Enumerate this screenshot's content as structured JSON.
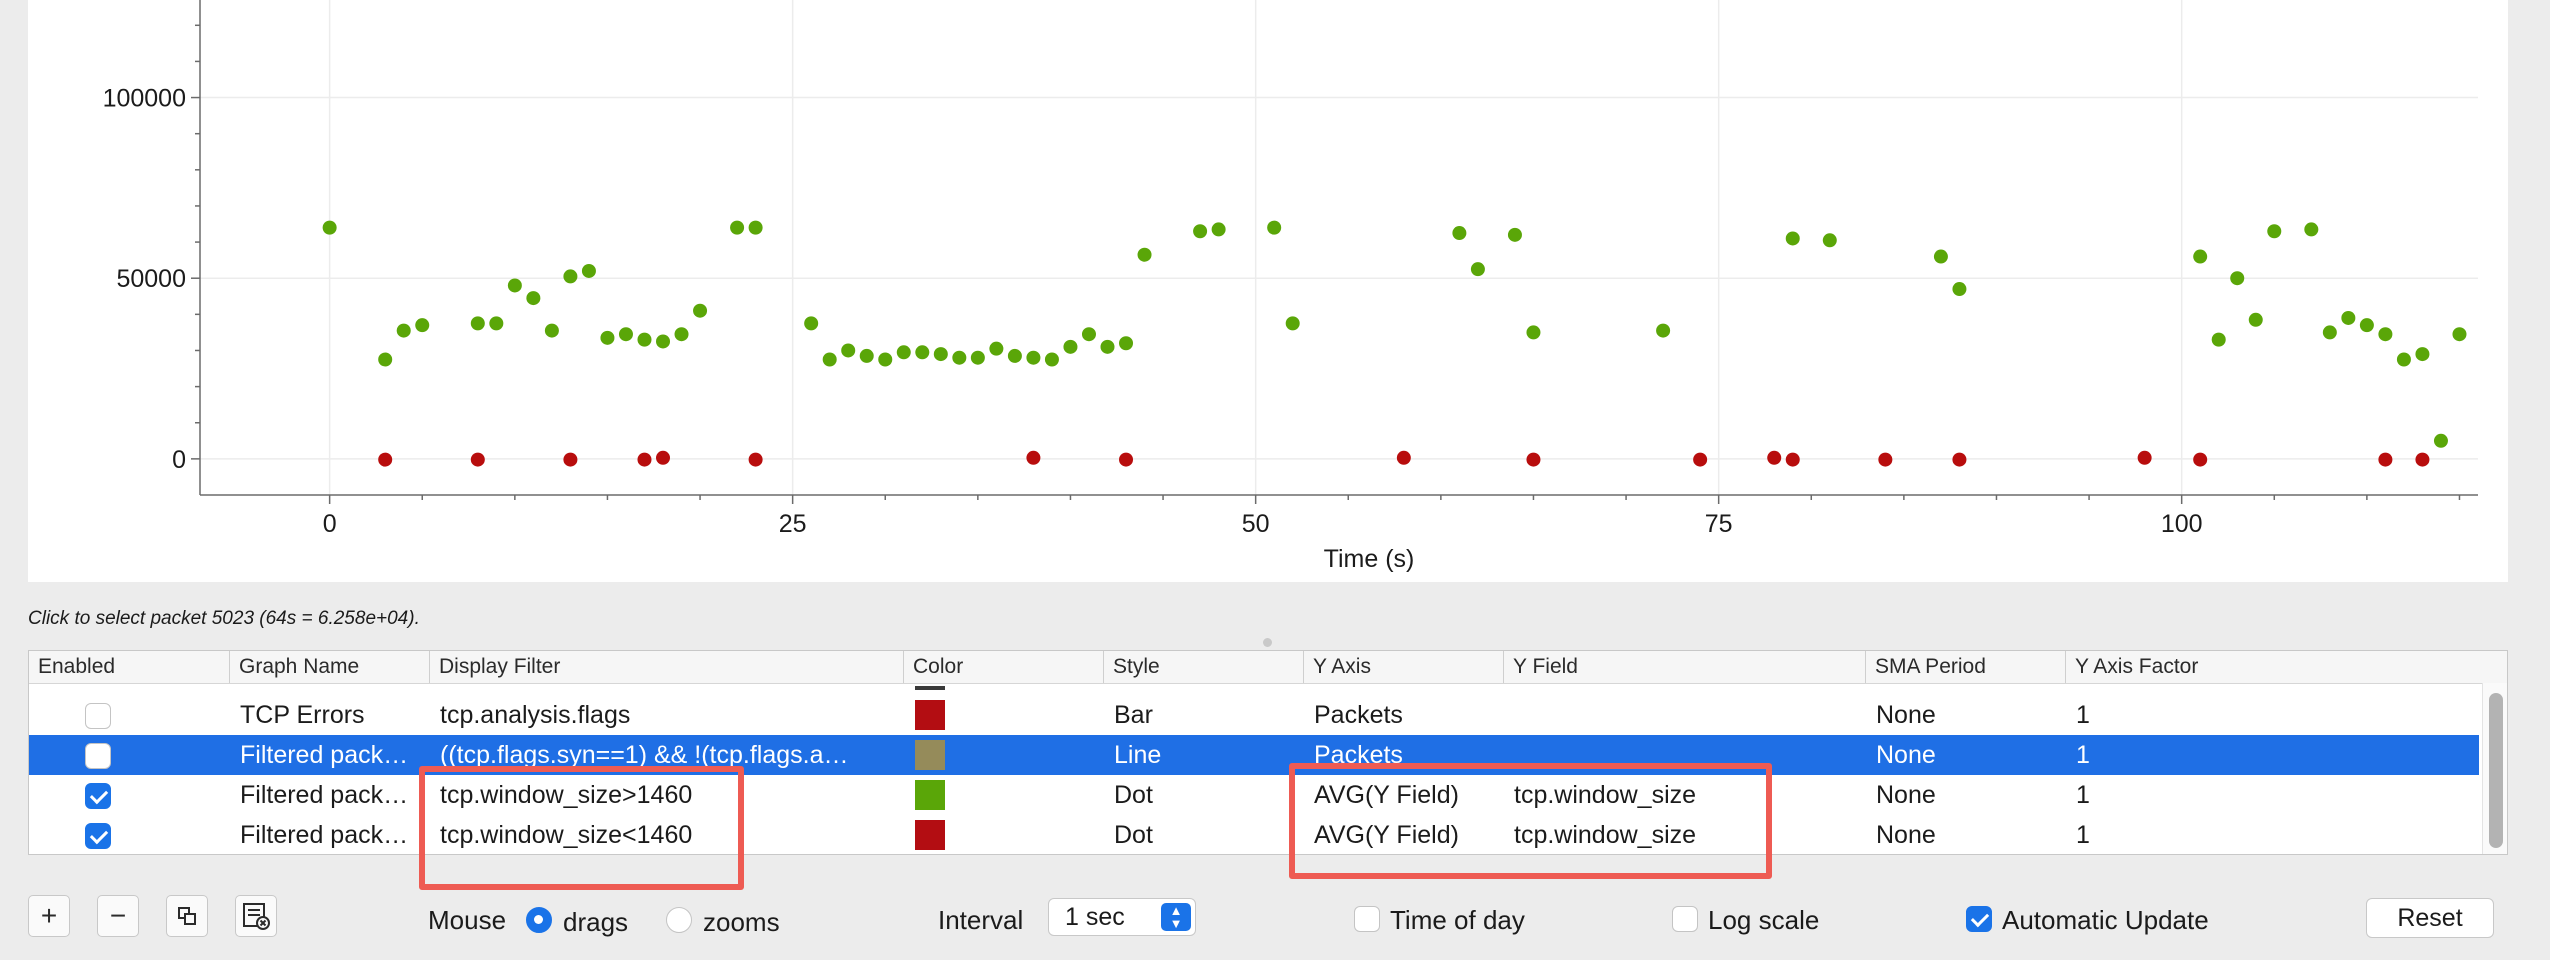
{
  "chart_data": {
    "type": "scatter",
    "title": "",
    "xlabel": "Time (s)",
    "ylabel": "",
    "xlim": [
      -7,
      116
    ],
    "ylim": [
      -10000,
      127000
    ],
    "xticks": [
      0,
      25,
      50,
      75,
      100
    ],
    "yticks": [
      0,
      50000,
      100000
    ],
    "grid": true,
    "legend": "none",
    "series": [
      {
        "color": "#5aa608",
        "points": [
          [
            0,
            64000
          ],
          [
            3,
            27500
          ],
          [
            4,
            35500
          ],
          [
            5,
            37000
          ],
          [
            8,
            37500
          ],
          [
            9,
            37500
          ],
          [
            10,
            48000
          ],
          [
            11,
            44500
          ],
          [
            12,
            35500
          ],
          [
            13,
            50500
          ],
          [
            14,
            52000
          ],
          [
            15,
            33500
          ],
          [
            16,
            34500
          ],
          [
            17,
            33000
          ],
          [
            18,
            32500
          ],
          [
            19,
            34500
          ],
          [
            20,
            41000
          ],
          [
            22,
            64000
          ],
          [
            23,
            64000
          ],
          [
            26,
            37500
          ],
          [
            27,
            27500
          ],
          [
            28,
            30000
          ],
          [
            29,
            28500
          ],
          [
            30,
            27500
          ],
          [
            31,
            29500
          ],
          [
            32,
            29500
          ],
          [
            33,
            29000
          ],
          [
            34,
            28000
          ],
          [
            35,
            28000
          ],
          [
            36,
            30500
          ],
          [
            37,
            28500
          ],
          [
            38,
            28000
          ],
          [
            39,
            27500
          ],
          [
            40,
            31000
          ],
          [
            41,
            34500
          ],
          [
            42,
            31000
          ],
          [
            43,
            32000
          ],
          [
            44,
            56500
          ],
          [
            47,
            63000
          ],
          [
            48,
            63500
          ],
          [
            51,
            64000
          ],
          [
            52,
            37500
          ],
          [
            61,
            62500
          ],
          [
            62,
            52500
          ],
          [
            64,
            62000
          ],
          [
            65,
            35000
          ],
          [
            72,
            35500
          ],
          [
            79,
            61000
          ],
          [
            81,
            60500
          ],
          [
            87,
            56000
          ],
          [
            88,
            47000
          ],
          [
            101,
            56000
          ],
          [
            102,
            33000
          ],
          [
            103,
            50000
          ],
          [
            104,
            38500
          ],
          [
            105,
            63000
          ],
          [
            107,
            63500
          ],
          [
            108,
            35000
          ],
          [
            109,
            39000
          ],
          [
            110,
            37000
          ],
          [
            111,
            34500
          ],
          [
            112,
            27500
          ],
          [
            113,
            29000
          ],
          [
            114,
            5000
          ],
          [
            115,
            34500
          ]
        ]
      },
      {
        "color": "#b80d0d",
        "points": [
          [
            3,
            -200
          ],
          [
            8,
            -200
          ],
          [
            13,
            -200
          ],
          [
            17,
            -200
          ],
          [
            18,
            300
          ],
          [
            23,
            -200
          ],
          [
            38,
            300
          ],
          [
            43,
            -200
          ],
          [
            58,
            300
          ],
          [
            65,
            -200
          ],
          [
            74,
            -200
          ],
          [
            78,
            300
          ],
          [
            79,
            -200
          ],
          [
            84,
            -200
          ],
          [
            88,
            -200
          ],
          [
            98,
            300
          ],
          [
            101,
            -200
          ],
          [
            111,
            -200
          ],
          [
            113,
            -200
          ]
        ]
      }
    ]
  },
  "status": "Click to select packet 5023 (64s = 6.258e+04).",
  "table": {
    "headers": [
      "Enabled",
      "Graph Name",
      "Display Filter",
      "Color",
      "Style",
      "Y Axis",
      "Y Field",
      "SMA Period",
      "Y Axis Factor"
    ],
    "rows": [
      {
        "enabled": false,
        "name": "TCP Errors",
        "filter": "tcp.analysis.flags",
        "color": "#b30d12",
        "style": "Bar",
        "y_axis": "Packets",
        "y_field": "",
        "sma": "None",
        "factor": "1",
        "selected": false
      },
      {
        "enabled": false,
        "name": "Filtered pack…",
        "filter": "((tcp.flags.syn==1) && !(tcp.flags.a…",
        "color": "#958b5a",
        "style": "Line",
        "y_axis": "Packets",
        "y_field": "",
        "sma": "None",
        "factor": "1",
        "selected": true
      },
      {
        "enabled": true,
        "name": "Filtered pack…",
        "filter": "tcp.window_size>1460",
        "color": "#5aa608",
        "style": "Dot",
        "y_axis": "AVG(Y Field)",
        "y_field": "tcp.window_size",
        "sma": "None",
        "factor": "1",
        "selected": false
      },
      {
        "enabled": true,
        "name": "Filtered pack…",
        "filter": "tcp.window_size<1460",
        "color": "#b30d12",
        "style": "Dot",
        "y_axis": "AVG(Y Field)",
        "y_field": "tcp.window_size",
        "sma": "None",
        "factor": "1",
        "selected": false
      }
    ]
  },
  "toolbar": {
    "add_icon": "plus-icon",
    "remove_icon": "minus-icon",
    "copy_icon": "copy-icon",
    "clear_icon": "clear-list-icon",
    "mouse_label": "Mouse",
    "mouse_drags": "drags",
    "mouse_zooms": "zooms",
    "mouse_mode": "drags",
    "interval_label": "Interval",
    "interval_value": "1 sec",
    "time_of_day_label": "Time of day",
    "time_of_day": false,
    "log_scale_label": "Log scale",
    "log_scale": false,
    "auto_update_label": "Automatic Update",
    "auto_update": true,
    "reset_label": "Reset"
  }
}
